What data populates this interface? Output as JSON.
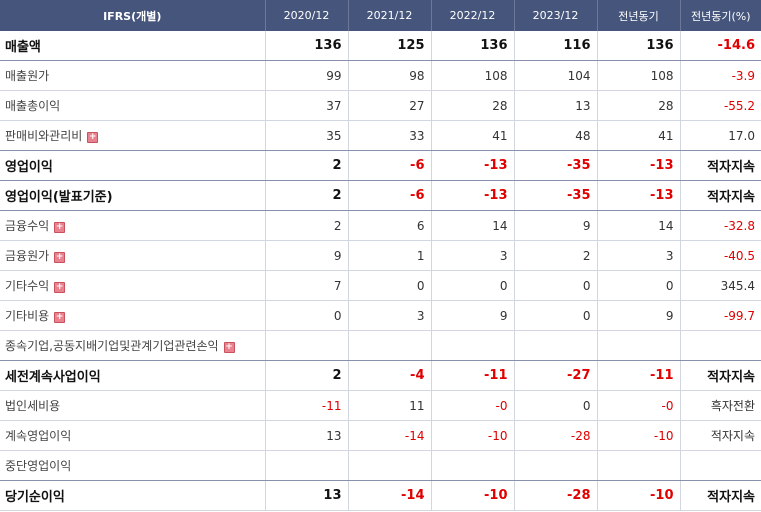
{
  "header": {
    "cols": [
      "IFRS(개별)",
      "2020/12",
      "2021/12",
      "2022/12",
      "2023/12",
      "전년동기",
      "전년동기(%)"
    ]
  },
  "rows": [
    {
      "label": "매출액",
      "bold": true,
      "sep": true,
      "expand": false,
      "values": [
        "136",
        "125",
        "136",
        "116",
        "136",
        "-14.6"
      ]
    },
    {
      "label": "매출원가",
      "bold": false,
      "sep": false,
      "expand": false,
      "values": [
        "99",
        "98",
        "108",
        "104",
        "108",
        "-3.9"
      ]
    },
    {
      "label": "매출총이익",
      "bold": false,
      "sep": false,
      "expand": false,
      "values": [
        "37",
        "27",
        "28",
        "13",
        "28",
        "-55.2"
      ]
    },
    {
      "label": "판매비와관리비",
      "bold": false,
      "sep": true,
      "expand": true,
      "values": [
        "35",
        "33",
        "41",
        "48",
        "41",
        "17.0"
      ]
    },
    {
      "label": "영업이익",
      "bold": true,
      "sep": true,
      "expand": false,
      "values": [
        "2",
        "-6",
        "-13",
        "-35",
        "-13",
        "적자지속"
      ]
    },
    {
      "label": "영업이익(발표기준)",
      "bold": true,
      "sep": true,
      "expand": false,
      "values": [
        "2",
        "-6",
        "-13",
        "-35",
        "-13",
        "적자지속"
      ]
    },
    {
      "label": "금융수익",
      "bold": false,
      "sep": false,
      "expand": true,
      "values": [
        "2",
        "6",
        "14",
        "9",
        "14",
        "-32.8"
      ]
    },
    {
      "label": "금융원가",
      "bold": false,
      "sep": false,
      "expand": true,
      "values": [
        "9",
        "1",
        "3",
        "2",
        "3",
        "-40.5"
      ]
    },
    {
      "label": "기타수익",
      "bold": false,
      "sep": false,
      "expand": true,
      "values": [
        "7",
        "0",
        "0",
        "0",
        "0",
        "345.4"
      ]
    },
    {
      "label": "기타비용",
      "bold": false,
      "sep": false,
      "expand": true,
      "values": [
        "0",
        "3",
        "9",
        "0",
        "9",
        "-99.7"
      ]
    },
    {
      "label": "종속기업,공동지배기업및관계기업관련손익",
      "bold": false,
      "sep": true,
      "expand": true,
      "values": [
        "",
        "",
        "",
        "",
        "",
        ""
      ]
    },
    {
      "label": "세전계속사업이익",
      "bold": true,
      "sep": false,
      "expand": false,
      "values": [
        "2",
        "-4",
        "-11",
        "-27",
        "-11",
        "적자지속"
      ]
    },
    {
      "label": "법인세비용",
      "bold": false,
      "sep": false,
      "expand": false,
      "values": [
        "-11",
        "11",
        "-0",
        "0",
        "-0",
        "흑자전환"
      ]
    },
    {
      "label": "계속영업이익",
      "bold": false,
      "sep": false,
      "expand": false,
      "values": [
        "13",
        "-14",
        "-10",
        "-28",
        "-10",
        "적자지속"
      ]
    },
    {
      "label": "중단영업이익",
      "bold": false,
      "sep": true,
      "expand": false,
      "values": [
        "",
        "",
        "",
        "",
        "",
        ""
      ]
    },
    {
      "label": "당기순이익",
      "bold": true,
      "sep": false,
      "expand": false,
      "values": [
        "13",
        "-14",
        "-10",
        "-28",
        "-10",
        "적자지속"
      ]
    }
  ]
}
